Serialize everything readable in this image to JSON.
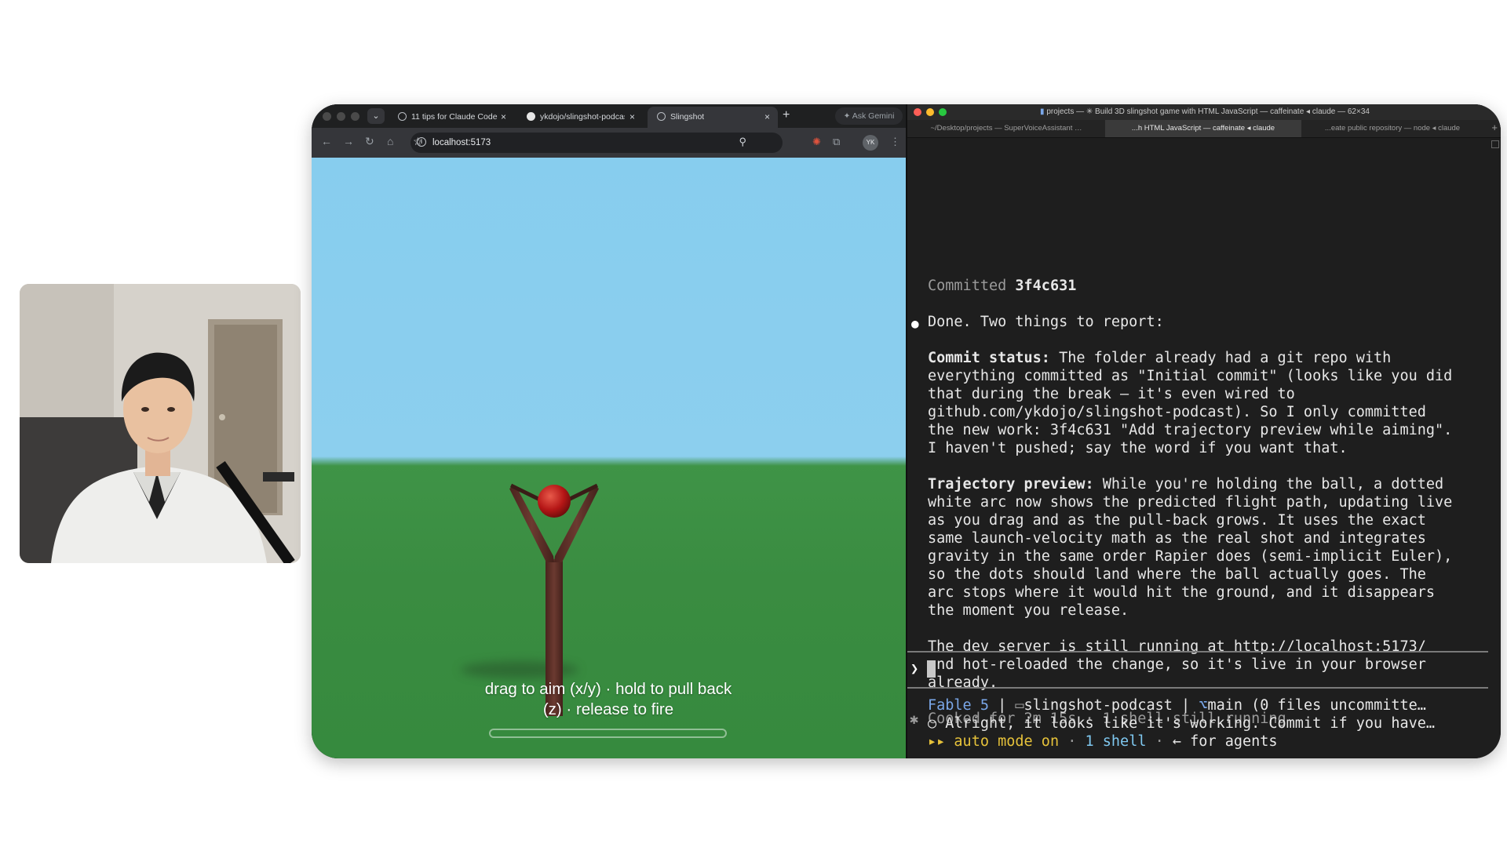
{
  "browser": {
    "tabs": [
      {
        "label": "11 tips for Claude Code",
        "icon": "globe-icon"
      },
      {
        "label": "ykdojo/slingshot-podcast",
        "icon": "github-icon"
      },
      {
        "label": "Slingshot",
        "icon": "globe-icon"
      }
    ],
    "active_tab_index": 2,
    "ask_gemini_label": "Ask Gemini",
    "url": "localhost:5173",
    "profile_initials": "YK"
  },
  "game": {
    "hint_line1": "drag to aim (x/y) · hold to pull back",
    "hint_line2": "(z) · release to fire",
    "power": 0.0,
    "sky_color": "#87cdee",
    "ground_color": "#3a8c41",
    "ball_color": "#b51616",
    "slingshot_color": "#5a2e26"
  },
  "terminal": {
    "window_title": "projects — ✳ Build 3D slingshot game with HTML JavaScript — caffeinate ◂ claude — 62×34",
    "tabs": [
      {
        "label": "~/Desktop/projects — SuperVoiceAssistant"
      },
      {
        "label": "...h HTML JavaScript — caffeinate ◂ claude"
      },
      {
        "label": "...eate public repository — node ◂ claude"
      }
    ],
    "committed_label": "Committed",
    "commit_hash": "3f4c631",
    "done_line": "Done. Two things to report:",
    "commit_status_heading": "Commit status:",
    "commit_status_lines": [
      " The folder already had a git repo with",
      "everything committed as \"Initial commit\" (looks like you did",
      "that during the break — it's even wired to",
      "github.com/ykdojo/slingshot-podcast). So I only committed",
      "the new work: 3f4c631 \"Add trajectory preview while aiming\".",
      "I haven't pushed; say the word if you want that."
    ],
    "trajectory_heading": "Trajectory preview:",
    "trajectory_lines": [
      " While you're holding the ball, a dotted",
      "white arc now shows the predicted flight path, updating live",
      "as you drag and as the pull-back grows. It uses the exact",
      "same launch-velocity math as the real shot and integrates",
      "gravity in the same order Rapier does (semi-implicit Euler),",
      "so the dots should land where the ball actually goes. The",
      "arc stops where it would hit the ground, and it disappears",
      "the moment you release."
    ],
    "dev_server_lines": [
      "The dev server is still running at http://localhost:5173/",
      "and hot-reloaded the change, so it's live in your browser",
      "already."
    ],
    "cooked_line": "Cooked for 2m 15s · 1 shell still running",
    "prompt_symbol": "❯",
    "status_model": "Fable 5",
    "status_folder": "slingshot-podcast",
    "status_branch": "main (0 files uncommitte…",
    "status_message": "Alright, it looks like it's working. Commit if you have…",
    "status_mode": "auto mode on",
    "status_shells": "1 shell",
    "status_hint": "← for agents"
  }
}
